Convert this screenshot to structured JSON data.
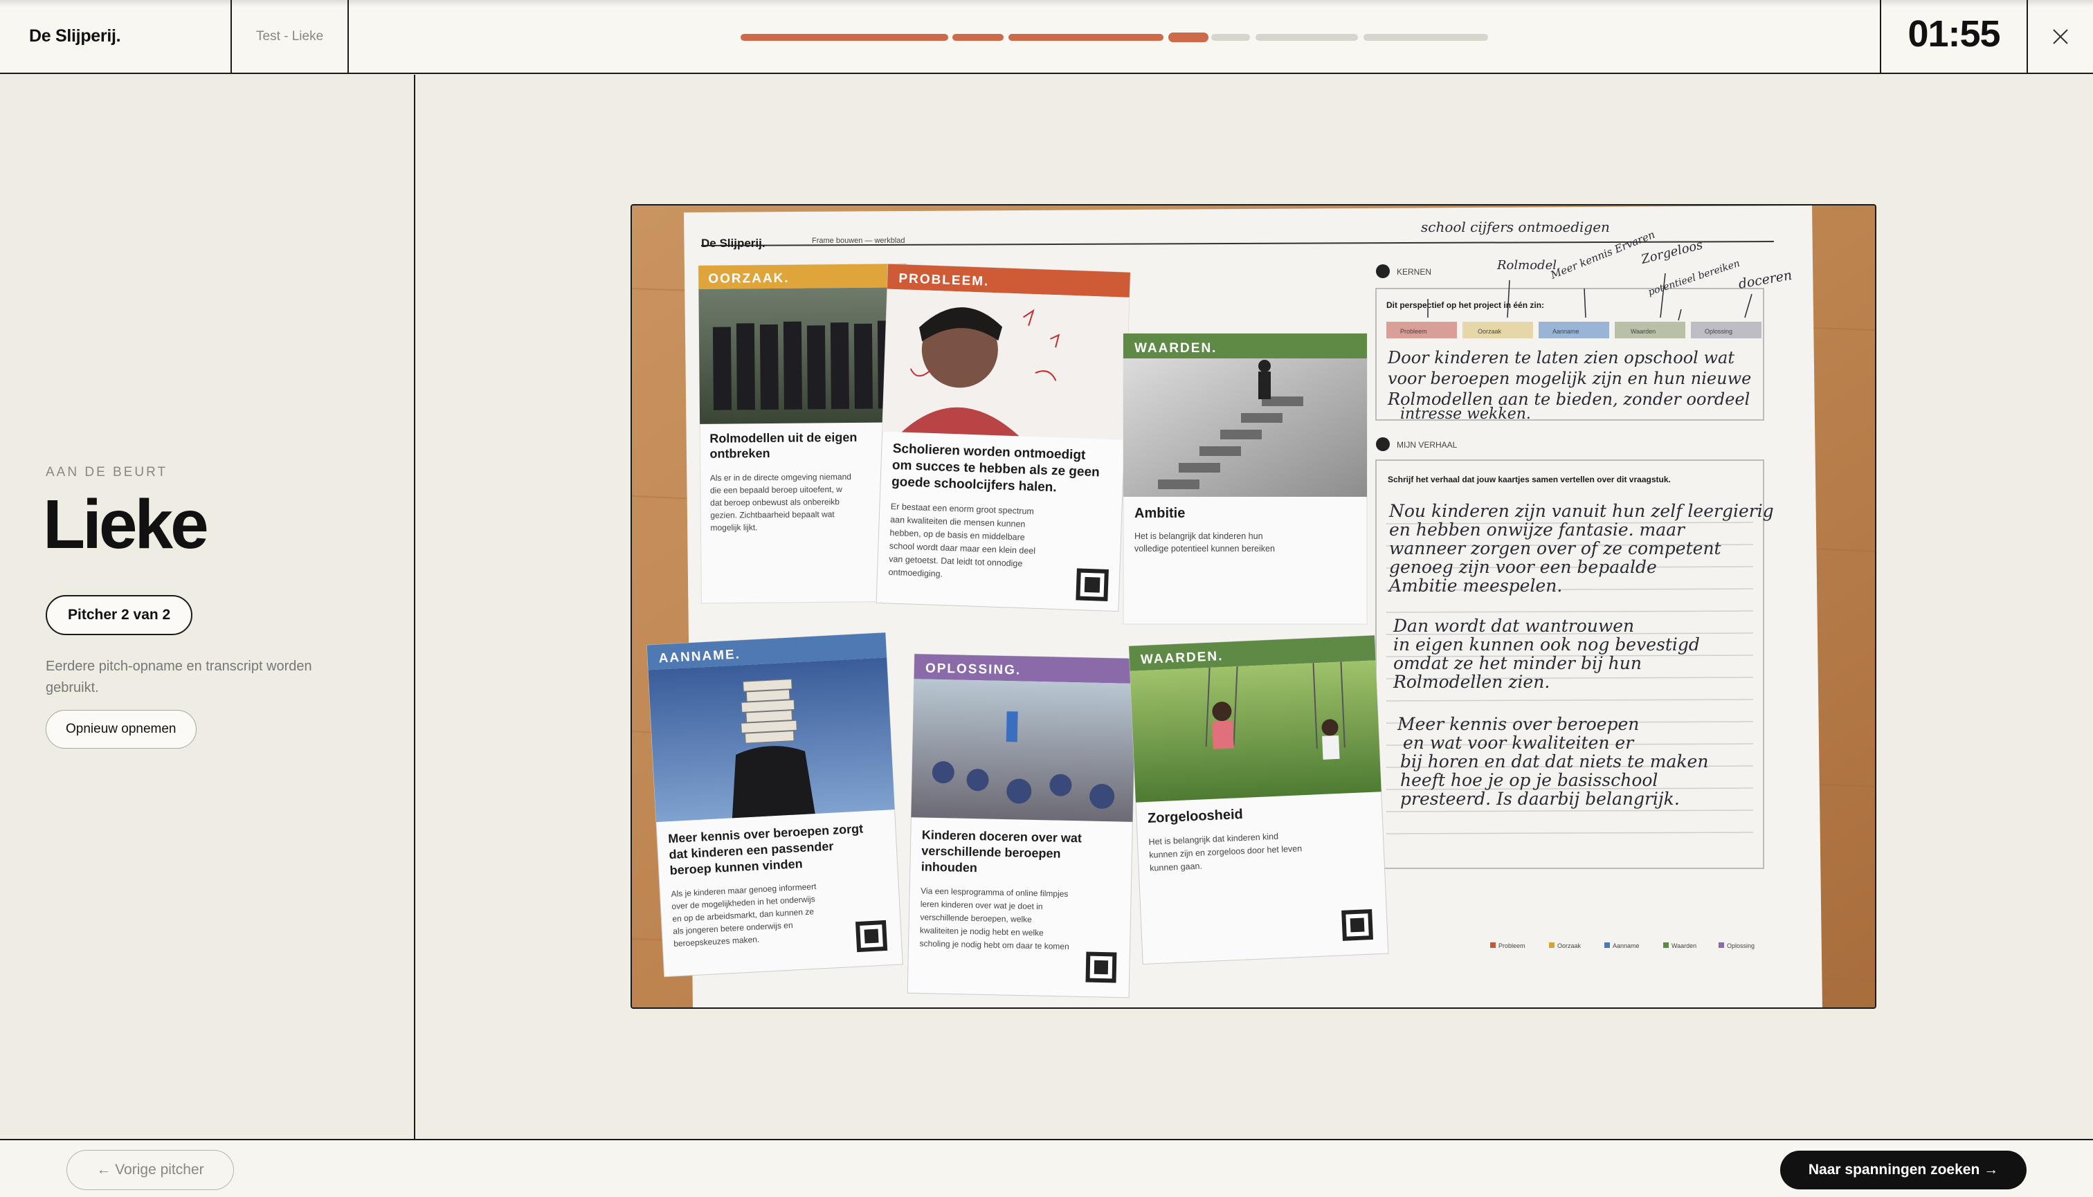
{
  "header": {
    "brand": "De Slijperij.",
    "session": "Test - Lieke",
    "progress_segments": [
      "done",
      "done",
      "done",
      "current",
      "todo",
      "todo",
      "todo"
    ],
    "timer": "01:55",
    "close_icon": "close-icon",
    "accent_color": "#cc6a4a"
  },
  "sidebar": {
    "turn_label": "AAN DE BEURT",
    "pitcher_name": "Lieke",
    "pitcher_badge": "Pitcher 2 van 2",
    "note": "Eerdere pitch-opname en transcript worden gebruikt.",
    "rerecord_label": "Opnieuw opnemen"
  },
  "photo": {
    "worksheet_brand": "De Slijperij.",
    "worksheet_subtitle": "Frame bouwen — werkblad",
    "section_kernen": "KERNEN",
    "perspective_prompt": "Dit perspectief op het project in één zin:",
    "chips": [
      "Probleem",
      "Oorzaak",
      "Aanname",
      "Waarden",
      "Oplossing"
    ],
    "section_verhaal": "MIJN VERHAAL",
    "story_prompt": "Schrijf het verhaal dat jouw kaartjes samen vertellen over dit vraagstuk.",
    "legend": [
      "Probleem",
      "Oorzaak",
      "Aanname",
      "Waarden",
      "Oplossing"
    ],
    "handwriting_top_notes": [
      "school cijfers ontmoedigen",
      "Rolmodel",
      "Meer kennis Ervaren",
      "Zorgeloos",
      "potentieel bereiken",
      "doceren"
    ],
    "handwriting_perspective": [
      "Door kinderen te laten zien opschool wat",
      "voor beroepen mogelijk zijn en hun nieuwe",
      "Rolmodellen aan te bieden, zonder oordeel",
      "intresse wekken."
    ],
    "handwriting_story": [
      "Nou kinderen zijn vanuit hun zelf leergierig",
      "en hebben onwijze fantasie. maar",
      "wanneer zorgen over of ze competent",
      "genoeg zijn voor een bepaalde",
      "Ambitie meespelen.",
      "Dan wordt dat wantrouwen",
      "in eigen kunnen ook nog bevestigd",
      "omdat ze het minder bij hun",
      "Rolmodellen zien.",
      "Meer kennis over beroepen",
      "en wat voor kwaliteiten er",
      "bij horen en dat dat niets te maken",
      "heeft hoe je op je basisschool",
      "presteerd. Is daarbij belangrijk."
    ],
    "cards": [
      {
        "tag": "OORZAAK.",
        "color": "#e0a53a",
        "title": [
          "Rolmodellen uit de eigen",
          "ontbreken"
        ],
        "body": [
          "Als er in de directe omgeving niemand",
          "die een bepaald beroep uitoefent, w",
          "dat beroep onbewust als onbereikb",
          "gezien. Zichtbaarheid bepaalt wat",
          "mogelijk lijkt."
        ]
      },
      {
        "tag": "PROBLEEM.",
        "color": "#cf5a36",
        "title": [
          "Scholieren worden ontmoedigt",
          "om succes te hebben als ze geen",
          "goede schoolcijfers halen."
        ],
        "body": [
          "Er bestaat een enorm groot spectrum",
          "aan kwaliteiten die mensen kunnen",
          "hebben, op de basis en middelbare",
          "school wordt daar maar een klein deel",
          "van getoetst. Dat leidt tot onnodige",
          "ontmoediging."
        ]
      },
      {
        "tag": "WAARDEN.",
        "color": "#5f8a45",
        "title": [
          "Ambitie"
        ],
        "body": [
          "Het is belangrijk dat kinderen hun",
          "volledige potentieel kunnen bereiken"
        ]
      },
      {
        "tag": "AANNAME.",
        "color": "#4e79b3",
        "title": [
          "Meer kennis over beroepen zorgt",
          "dat kinderen een passender",
          "beroep kunnen vinden"
        ],
        "body": [
          "Als je kinderen maar genoeg informeert",
          "over de mogelijkheden in het onderwijs",
          "en op de arbeidsmarkt, dan kunnen ze",
          "als jongeren betere onderwijs en",
          "beroepskeuzes maken."
        ]
      },
      {
        "tag": "OPLOSSING.",
        "color": "#8a6aa8",
        "title": [
          "Kinderen doceren over wat",
          "verschillende beroepen",
          "inhouden"
        ],
        "body": [
          "Via een lesprogramma of online filmpjes",
          "leren kinderen over wat je doet in",
          "verschillende beroepen, welke",
          "kwaliteiten je nodig hebt en welke",
          "scholing je nodig hebt om daar te komen"
        ]
      },
      {
        "tag": "WAARDEN.",
        "color": "#5f8a45",
        "title": [
          "Zorgeloosheid"
        ],
        "body": [
          "Het is belangrijk dat kinderen kind",
          "kunnen zijn en zorgeloos door het leven",
          "kunnen gaan."
        ]
      }
    ]
  },
  "footer": {
    "prev_label": "← Vorige pitcher",
    "next_label": "Naar spanningen zoeken →"
  }
}
